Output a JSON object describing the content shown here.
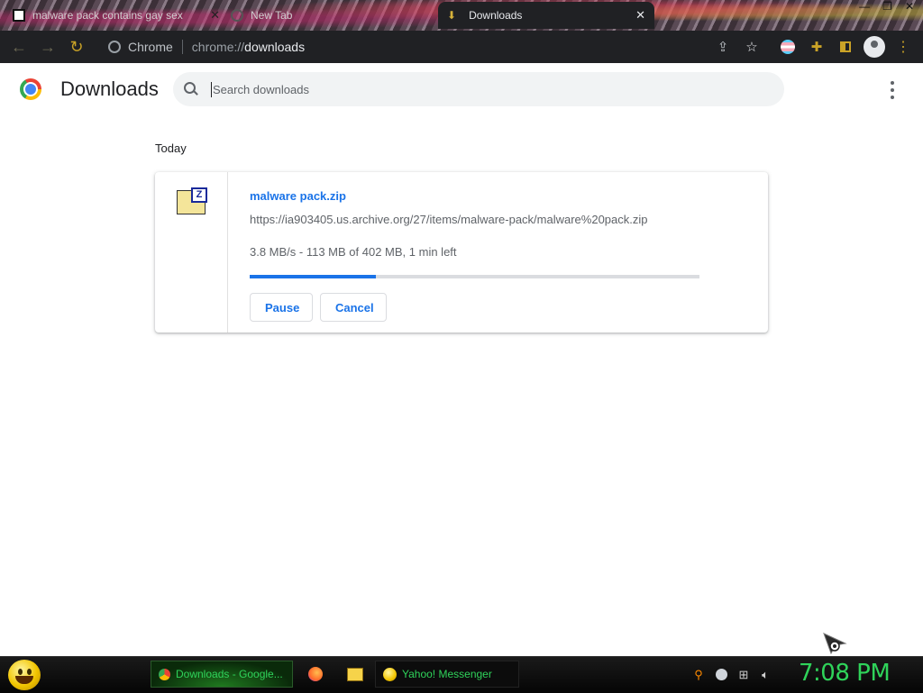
{
  "browser": {
    "tabs": [
      {
        "title": "malware pack contains gay sex",
        "active": false
      },
      {
        "title": "New Tab",
        "active": false
      },
      {
        "title": "Downloads",
        "active": true
      }
    ],
    "omnibox": {
      "site_label": "Chrome",
      "url_scheme": "chrome://",
      "url_host": "downloads"
    }
  },
  "page": {
    "title": "Downloads",
    "search": {
      "placeholder": "Search downloads",
      "value": ""
    }
  },
  "downloads": {
    "date_header": "Today",
    "items": [
      {
        "file_name": "malware pack.zip",
        "url": "https://ia903405.us.archive.org/27/items/malware-pack/malware%20pack.zip",
        "status": "3.8 MB/s - 113 MB of 402 MB, 1 min left",
        "progress": 0.28,
        "pause_label": "Pause",
        "cancel_label": "Cancel"
      }
    ]
  },
  "taskbar": {
    "chrome_task": "Downloads - Google...",
    "yahoo_task": "Yahoo! Messenger",
    "clock": "7:08 PM"
  },
  "colors": {
    "accent": "#1a73e8",
    "toolbar_bg": "#202124",
    "taskbar_text": "#2fd35a",
    "icon_gold": "#c9a227"
  }
}
